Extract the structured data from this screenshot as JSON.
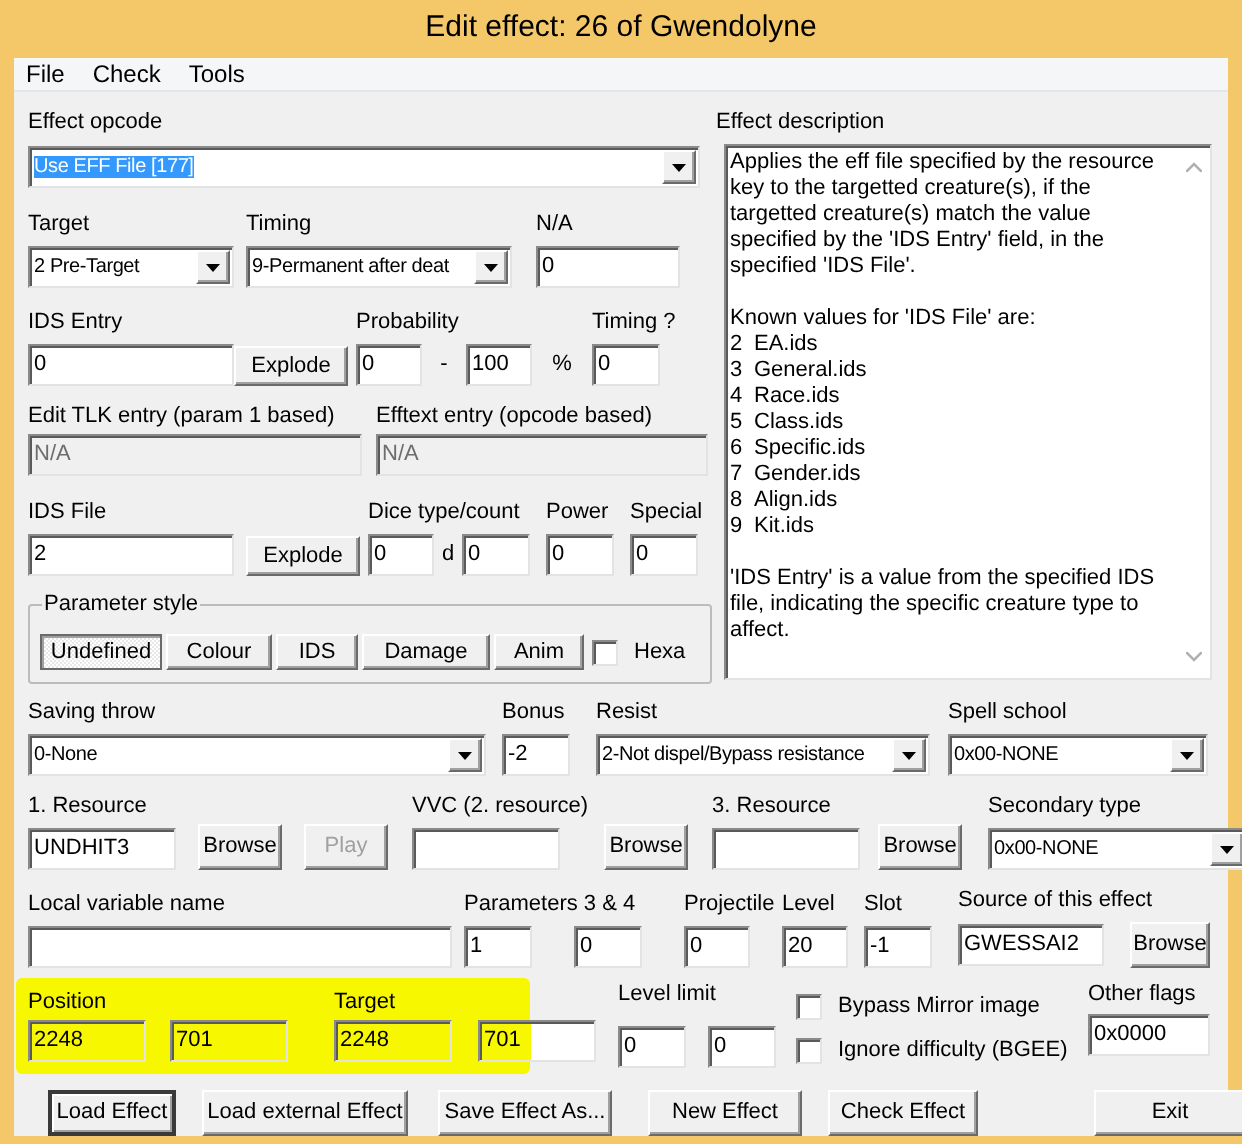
{
  "window": {
    "title": "Edit effect: 26 of Gwendolyne"
  },
  "menu": [
    "File",
    "Check",
    "Tools"
  ],
  "effect_opcode": {
    "label": "Effect opcode",
    "value": "Use EFF File [177]",
    "text_selected": true
  },
  "target": {
    "label": "Target",
    "value": "2 Pre-Target"
  },
  "timing": {
    "label": "Timing",
    "value": "9-Permanent after deat"
  },
  "na": {
    "label": "N/A",
    "value": "0"
  },
  "ids_entry": {
    "label": "IDS Entry",
    "value": "0",
    "button": "Explode"
  },
  "probability": {
    "label": "Probability",
    "min": "0",
    "separator": "-",
    "max": "100",
    "unit": "%"
  },
  "timing_q": {
    "label": "Timing ?",
    "value": "0"
  },
  "tlk_entry": {
    "label": "Edit TLK entry (param 1 based)",
    "value": "N/A",
    "disabled": true
  },
  "efftext_entry": {
    "label": "Efftext entry (opcode based)",
    "value": "N/A",
    "disabled": true
  },
  "ids_file": {
    "label": "IDS File",
    "value": "2",
    "button": "Explode"
  },
  "dice": {
    "label": "Dice type/count",
    "type": "0",
    "separator": "d",
    "count": "0"
  },
  "power": {
    "label": "Power",
    "value": "0"
  },
  "special": {
    "label": "Special",
    "value": "0"
  },
  "parameter_style": {
    "label": "Parameter style",
    "buttons": [
      {
        "label": "Undefined",
        "selected": true
      },
      {
        "label": "Colour",
        "selected": false
      },
      {
        "label": "IDS",
        "selected": false
      },
      {
        "label": "Damage",
        "selected": false
      },
      {
        "label": "Anim",
        "selected": false
      }
    ],
    "hexa": {
      "label": "Hexa",
      "checked": false
    }
  },
  "description": {
    "label": "Effect description",
    "intro": "Applies the eff file specified by the resource key to the targetted creature(s), if the targetted creature(s) match the value specified by the 'IDS Entry' field, in the specified 'IDS File'.",
    "known_heading": "Known values for 'IDS File' are:",
    "known_values": [
      {
        "number": "2",
        "name": "EA.ids"
      },
      {
        "number": "3",
        "name": "General.ids"
      },
      {
        "number": "4",
        "name": "Race.ids"
      },
      {
        "number": "5",
        "name": "Class.ids"
      },
      {
        "number": "6",
        "name": "Specific.ids"
      },
      {
        "number": "7",
        "name": "Gender.ids"
      },
      {
        "number": "8",
        "name": "Align.ids"
      },
      {
        "number": "9",
        "name": "Kit.ids"
      }
    ],
    "note": "'IDS Entry' is a value from the specified IDS file, indicating the specific creature type to affect."
  },
  "saving_throw": {
    "label": "Saving throw",
    "value": "0-None"
  },
  "bonus": {
    "label": "Bonus",
    "value": "-2"
  },
  "resist": {
    "label": "Resist",
    "value": "2-Not dispel/Bypass resistance"
  },
  "spell_school": {
    "label": "Spell school",
    "value": "0x00-NONE"
  },
  "resource_1": {
    "label": "1. Resource",
    "value": "UNDHIT3",
    "browse": "Browse",
    "play": {
      "label": "Play",
      "disabled": true
    }
  },
  "vvc": {
    "label": "VVC (2. resource)",
    "browse": "Browse"
  },
  "resource_3": {
    "label": "3. Resource",
    "browse": "Browse"
  },
  "secondary_type": {
    "label": "Secondary type",
    "value": "0x00-NONE"
  },
  "local_variable": {
    "label": "Local variable name"
  },
  "parameters_3_4": {
    "label": "Parameters 3 & 4",
    "values": [
      "1",
      "0"
    ]
  },
  "projectile": {
    "label": "Projectile",
    "value": "0"
  },
  "level": {
    "label": "Level",
    "value": "20"
  },
  "slot": {
    "label": "Slot",
    "value": "-1"
  },
  "source": {
    "label": "Source of this effect",
    "value": "GWESSAI2",
    "browse": "Browse"
  },
  "position": {
    "label": "Position",
    "values": [
      "2248",
      "701"
    ]
  },
  "target_point": {
    "label": "Target",
    "values": [
      "2248",
      "701"
    ]
  },
  "level_limit": {
    "label": "Level limit",
    "values": [
      "0",
      "0"
    ]
  },
  "checkboxes": [
    {
      "label": "Bypass Mirror image",
      "checked": false
    },
    {
      "label": "Ignore difficulty (BGEE)",
      "checked": false
    }
  ],
  "other_flags": {
    "label": "Other flags",
    "value": "0x0000"
  },
  "buttons": [
    {
      "label": "Load Effect",
      "default": true
    },
    {
      "label": "Load external Effect",
      "default": false
    },
    {
      "label": "Save Effect As...",
      "default": false
    },
    {
      "label": "New Effect",
      "default": false
    },
    {
      "label": "Check Effect",
      "default": false
    },
    {
      "label": "Exit",
      "default": false
    }
  ]
}
